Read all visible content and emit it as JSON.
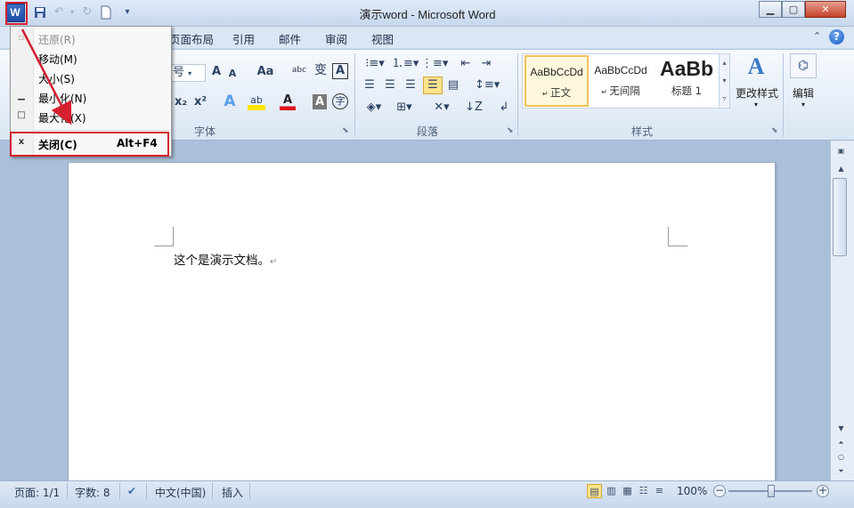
{
  "titlebar": {
    "title": "演示word  -  Microsoft Word",
    "app_icon": "W",
    "minimize": "▁",
    "maximize": "▢",
    "close": "✕"
  },
  "quick_access": {
    "save": "save-icon",
    "undo": "undo-icon",
    "redo": "redo-icon",
    "new": "new-doc-icon",
    "customize": "customize-icon"
  },
  "tabs": [
    "页面布局",
    "引用",
    "邮件",
    "审阅",
    "视图"
  ],
  "tab_partial": "页面布局",
  "ribbon": {
    "font_group": {
      "label": "字体",
      "font_size_suffix": "号",
      "grow": "A",
      "shrink": "A",
      "change_case": "Aa",
      "phonetic": "abc",
      "clear": "A",
      "sub": "x₂",
      "sup": "x²",
      "text_effect": "A",
      "highlight": "ab",
      "font_color": "A",
      "char_shade": "A",
      "enclose": "字"
    },
    "paragraph_group": {
      "label": "段落"
    },
    "styles_group": {
      "label": "样式",
      "items": [
        {
          "preview": "AaBbCcDd",
          "name": "正文"
        },
        {
          "preview": "AaBbCcDd",
          "name": "无间隔"
        },
        {
          "preview": "AaBb",
          "name": "标题 1"
        }
      ],
      "change_styles": "更改样式"
    },
    "editing_group": {
      "label": "编辑"
    }
  },
  "system_menu": {
    "items": [
      {
        "label": "还原(R)",
        "disabled": true,
        "glyph": "▫"
      },
      {
        "label": "移动(M)",
        "disabled": false,
        "glyph": ""
      },
      {
        "label": "大小(S)",
        "disabled": false,
        "glyph": ""
      },
      {
        "label": "最小化(N)",
        "disabled": false,
        "glyph": "▁"
      },
      {
        "label": "最大化(X)",
        "disabled": false,
        "glyph": "□"
      }
    ],
    "close": {
      "label": "关闭(C)",
      "shortcut": "Alt+F4",
      "glyph": "x"
    }
  },
  "document": {
    "text": "这个是演示文档。",
    "para_mark": "↵"
  },
  "statusbar": {
    "page": "页面: 1/1",
    "words": "字数: 8",
    "language": "中文(中国)",
    "mode": "插入",
    "zoom": "100%"
  },
  "colors": {
    "annotation_red": "#d4202f",
    "style_selected": "#f2c15a"
  }
}
